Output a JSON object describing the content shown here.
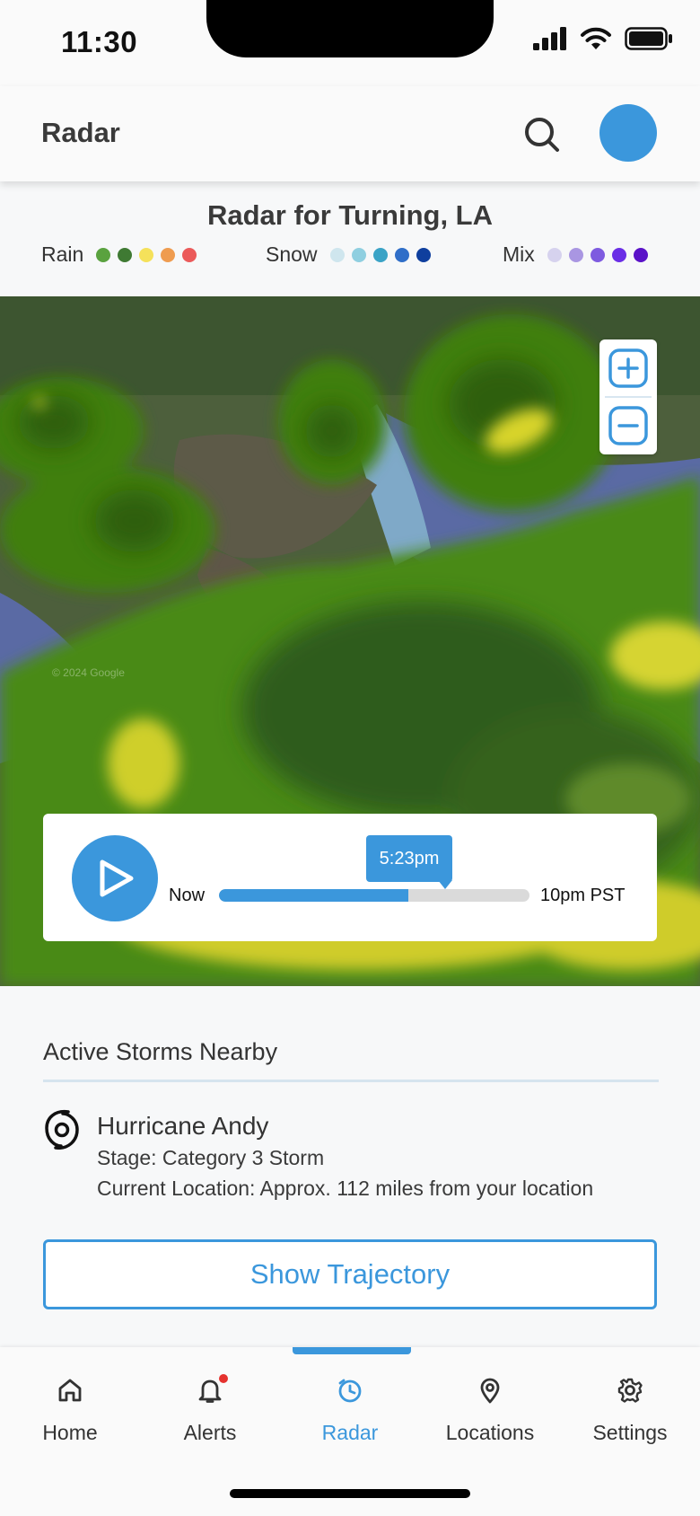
{
  "status_bar": {
    "time": "11:30"
  },
  "header": {
    "title": "Radar",
    "search_icon": "search-icon",
    "avatar_color": "#3b97dc"
  },
  "radar": {
    "title": "Radar for Turning, LA",
    "legend": [
      {
        "label": "Rain",
        "colors": [
          "#5aa23f",
          "#3f7a33",
          "#f5e15a",
          "#ef9c50",
          "#eb5a5a"
        ]
      },
      {
        "label": "Snow",
        "colors": [
          "#cfe6ee",
          "#8fcfe0",
          "#3aa3c6",
          "#2f6ec8",
          "#0f3f9e"
        ]
      },
      {
        "label": "Mix",
        "colors": [
          "#d6d2ee",
          "#a996e2",
          "#7e5be0",
          "#6a2ee6",
          "#5a12c8"
        ]
      }
    ]
  },
  "map": {
    "watermark": "© 2024 Google",
    "zoom_in_icon": "plus-icon",
    "zoom_out_icon": "minus-icon"
  },
  "player": {
    "start_label": "Now",
    "end_label": "10pm PST",
    "current_time": "5:23pm",
    "progress_percent": 61,
    "play_icon": "play-icon"
  },
  "storms": {
    "section_title": "Active Storms Nearby",
    "items": [
      {
        "name": "Hurricane Andy",
        "stage": "Stage: Category 3 Storm",
        "location": "Current Location: Approx. 112 miles from your location",
        "icon": "hurricane-icon"
      }
    ],
    "action_label": "Show Trajectory"
  },
  "tabs": [
    {
      "label": "Home",
      "icon": "home-icon",
      "active": false
    },
    {
      "label": "Alerts",
      "icon": "bell-icon",
      "active": false,
      "badge": true
    },
    {
      "label": "Radar",
      "icon": "radar-icon",
      "active": true
    },
    {
      "label": "Locations",
      "icon": "location-pin-icon",
      "active": false
    },
    {
      "label": "Settings",
      "icon": "gear-icon",
      "active": false
    }
  ],
  "colors": {
    "accent": "#3b97dc",
    "alert_badge": "#e5322e"
  }
}
